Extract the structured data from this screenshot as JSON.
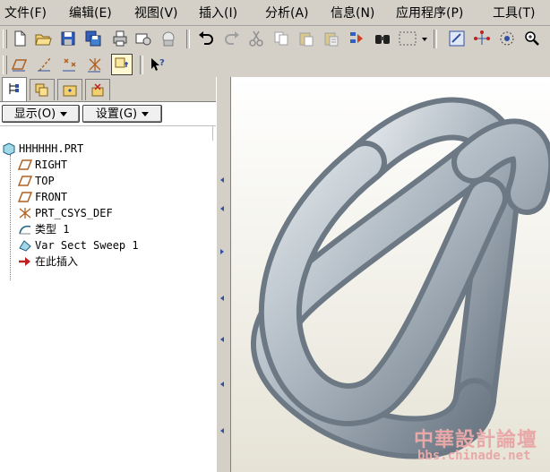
{
  "menubar": {
    "items": [
      "文件(F)",
      "编辑(E)",
      "视图(V)",
      "插入(I)",
      "分析(A)",
      "信息(N)",
      "应用程序(P)",
      "工具(T)"
    ]
  },
  "toolbar1": {
    "icons": [
      "new-file",
      "open-folder",
      "save",
      "save-copy",
      "print",
      "send-mail",
      "undo",
      "redo",
      "cut",
      "copy",
      "paste",
      "paste-special",
      "regenerate",
      "find",
      "select-box",
      "dropdown-arrow",
      "view-manager",
      "datum-axis",
      "orient",
      "zoom-in"
    ]
  },
  "toolbar2": {
    "icons": [
      "datum-plane-display",
      "datum-axis-display",
      "datum-point-display",
      "coord-sys-display",
      "spin-center",
      "context-help"
    ]
  },
  "left_panel": {
    "tabs": [
      "model-tree",
      "layer-tree",
      "folder-browser",
      "favorites"
    ],
    "display_label": "显示(O)",
    "settings_label": "设置(G)",
    "tree": [
      {
        "label": "HHHHHH.PRT",
        "icon": "part-icon"
      },
      {
        "label": "RIGHT",
        "icon": "datum-plane-icon"
      },
      {
        "label": "TOP",
        "icon": "datum-plane-icon"
      },
      {
        "label": "FRONT",
        "icon": "datum-plane-icon"
      },
      {
        "label": "PRT_CSYS_DEF",
        "icon": "coord-sys-icon"
      },
      {
        "label": "类型 1",
        "icon": "feature-icon"
      },
      {
        "label": "Var Sect Sweep 1",
        "icon": "sweep-icon"
      },
      {
        "label": "在此插入",
        "icon": "insert-here-icon"
      }
    ]
  },
  "watermark": {
    "title": "中華設計論壇",
    "url": "bbs.chinade.net"
  },
  "colors": {
    "tube_light": "#e3e8ec",
    "tube_mid": "#a9b4be",
    "tube_dark": "#6c7884",
    "accent_blue": "#3050a0"
  }
}
